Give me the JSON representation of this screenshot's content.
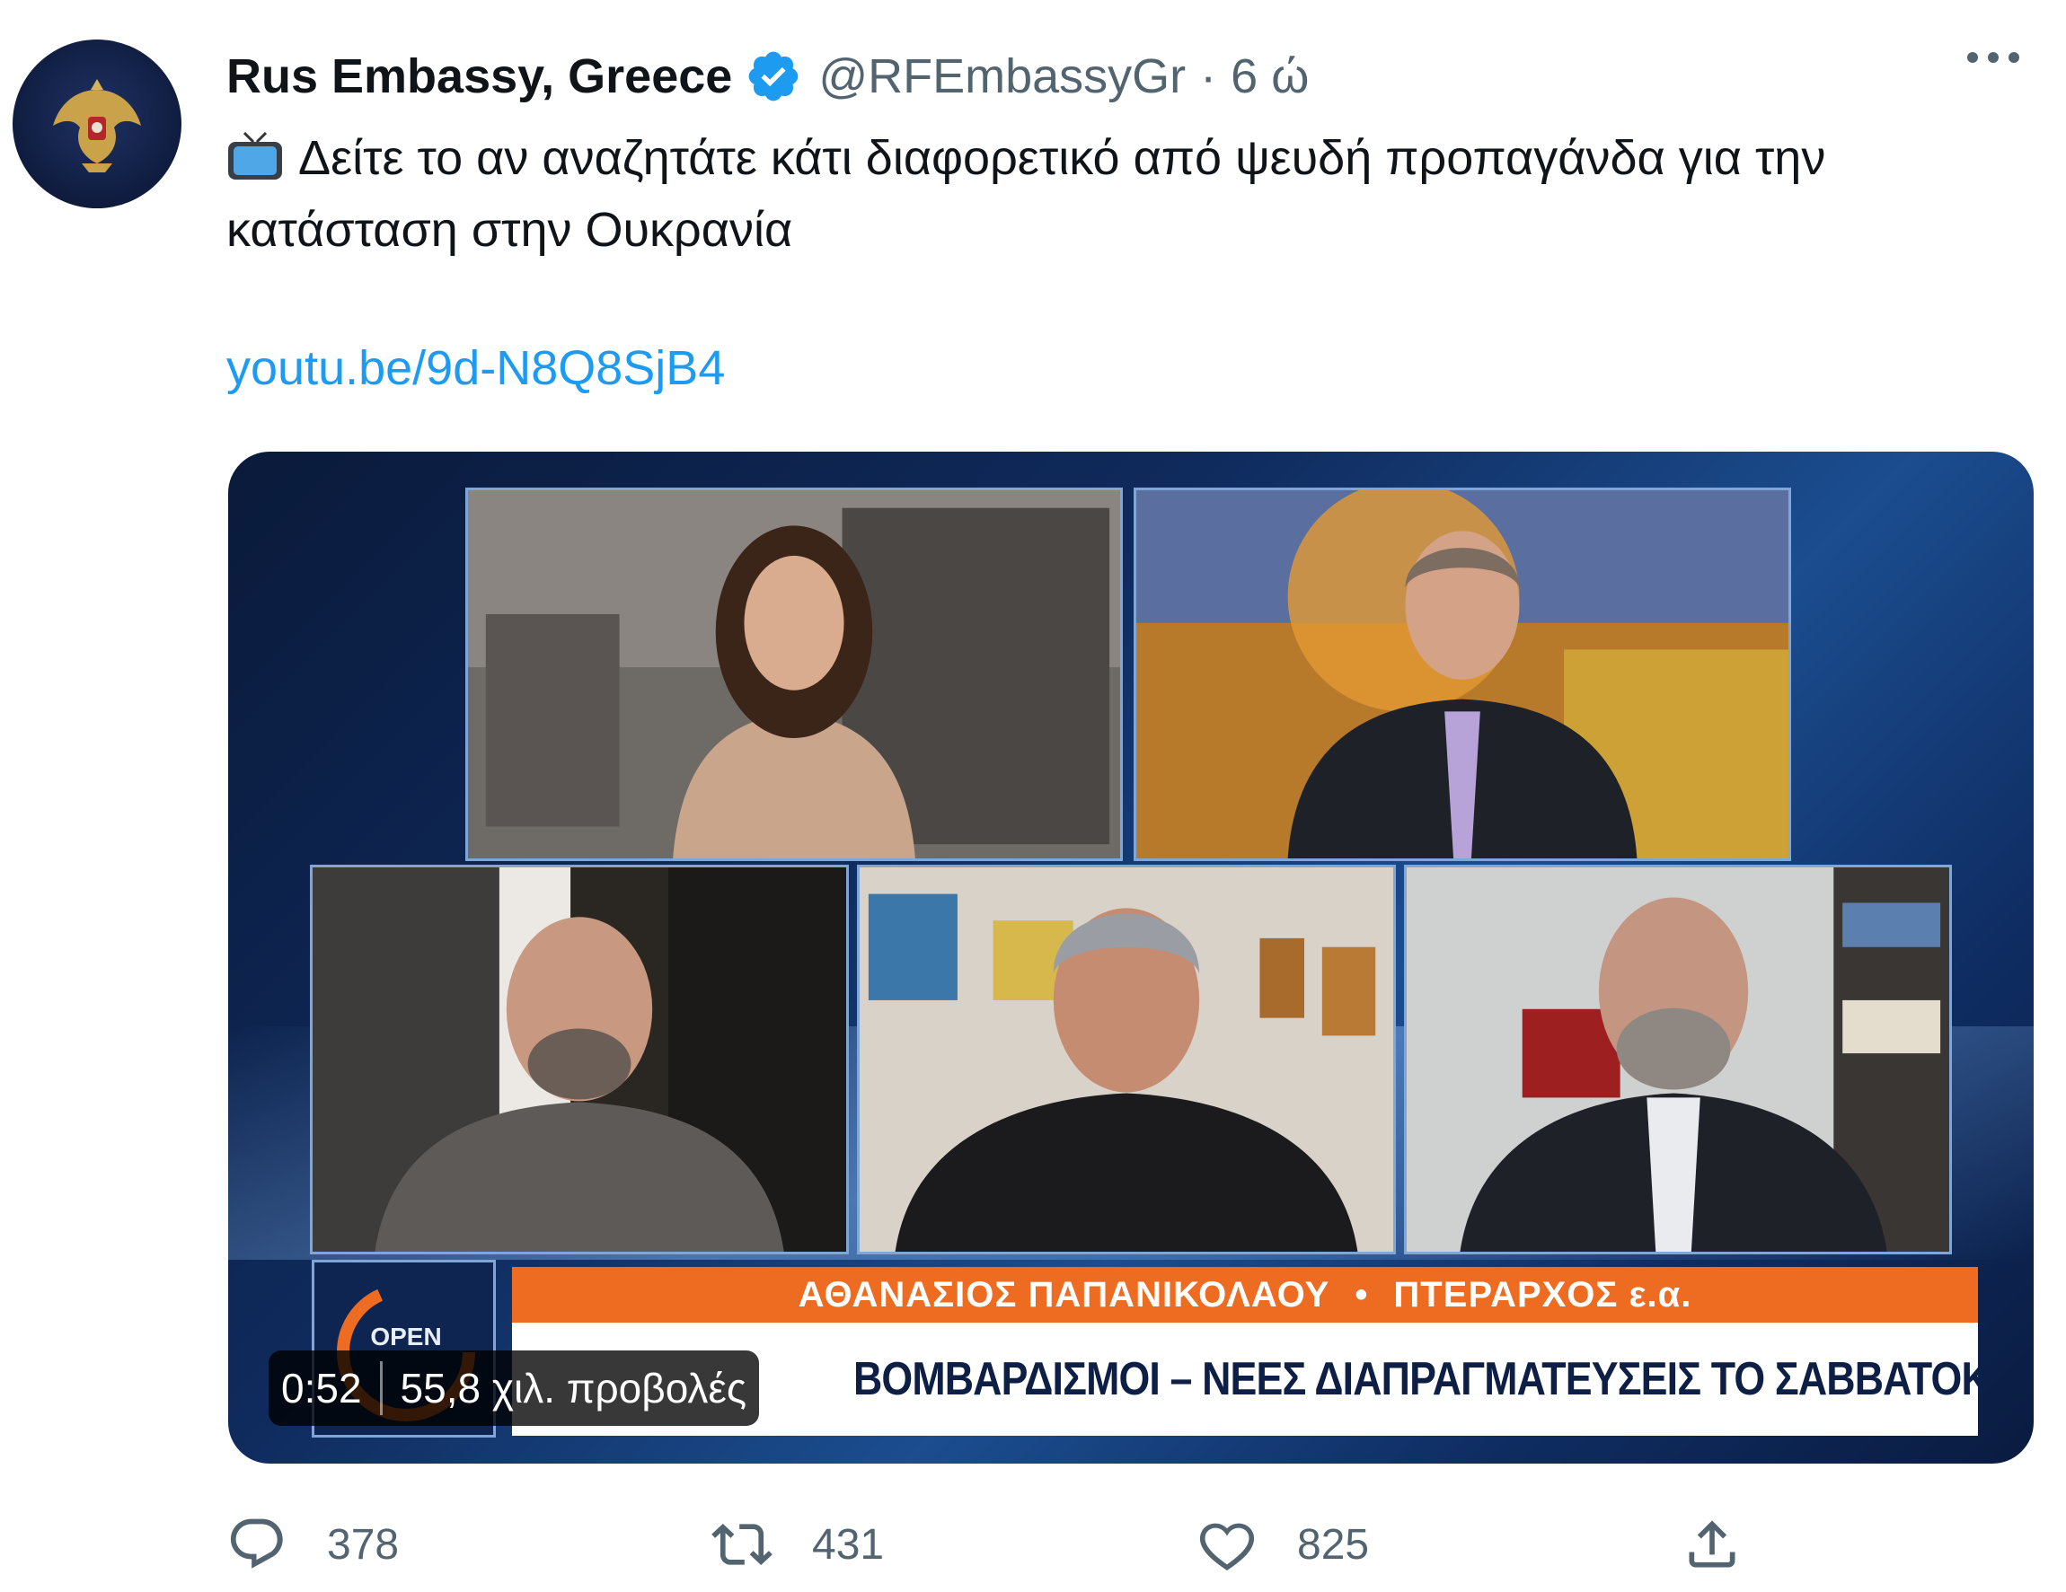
{
  "tweet": {
    "author_name": "Rus Embassy, Greece",
    "handle": "@RFEmbassyGr",
    "separator": "·",
    "time": "6 ώ",
    "text": "Δείτε το αν αναζητάτε κάτι διαφορετικό από ψευδή προπαγάνδα για την κατάσταση στην Ουκρανία",
    "link": "youtu.be/9d-N8Q8SjB4",
    "icons": {
      "avatar": "embassy-eagle-emblem",
      "verified": "verified-badge-icon",
      "more": "more-options-icon",
      "emoji": "tv-emoji"
    }
  },
  "video": {
    "lower_third_name": "ΑΘΑΝΑΣΙΟΣ ΠΑΠΑΝΙΚΟΛΑΟΥ",
    "lower_third_dot": "•",
    "lower_third_title": "ΠΤΕΡΑΡΧΟΣ ε.α.",
    "headline_visible": "ΒΟΜΒΑΡΔΙΣΜΟΙ – ΝΕΕΣ ΔΙΑΠΡΑΓΜΑΤΕΥΣΕΙΣ ΤΟ ΣΑΒΒΑΤΟΚΥΡΙΑΚΟ",
    "channel_logo_text": "OPEN",
    "duration": "0:52",
    "views": "55,8 χιλ. προβολές"
  },
  "actions": [
    {
      "icon": "reply-icon",
      "count": "378"
    },
    {
      "icon": "retweet-icon",
      "count": "431"
    },
    {
      "icon": "like-icon",
      "count": "825"
    },
    {
      "icon": "share-icon",
      "count": ""
    }
  ],
  "colors": {
    "accent_link": "#1d9bf0",
    "verified": "#1d9bf0",
    "secondary_text": "#536471",
    "lower_third_orange": "#ee6c22"
  }
}
